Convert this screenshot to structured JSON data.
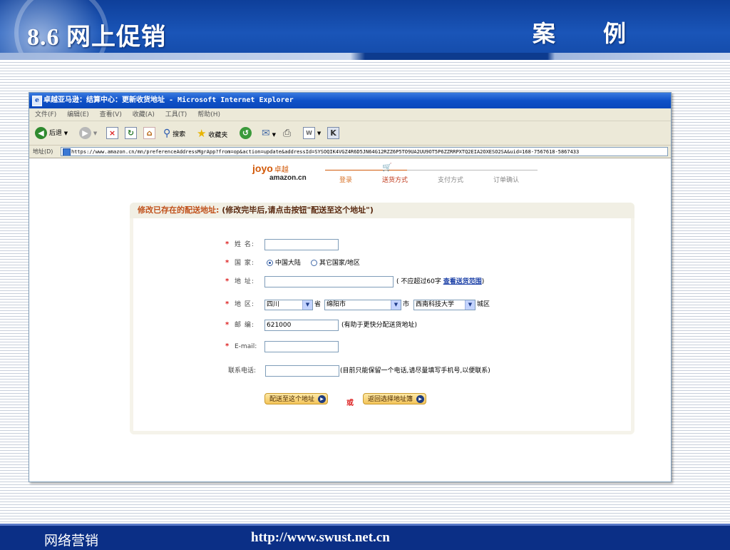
{
  "slide": {
    "title": "8.6 网上促销",
    "subtitle": "案 例",
    "footer_left": "网络营销",
    "footer_right": "http://www.swust.net.cn"
  },
  "ie": {
    "window_title": "卓越亚马逊：结算中心：更新收货地址 - Microsoft Internet Explorer",
    "menu": [
      "文件(F)",
      "编辑(E)",
      "查看(V)",
      "收藏(A)",
      "工具(T)",
      "帮助(H)"
    ],
    "toolbar": {
      "back_label": "后退",
      "search_label": "搜索",
      "favorites_label": "收藏夹"
    },
    "address_label": "地址(D)",
    "url": "https://www.amazon.cn/mn/preferenceAddressMgrApp?from=op&action=update&addressId=SYSOQIK4VGZ4R6D5JN64G12RZZ6P5TO9UA2UU9OT5P6ZZRRPXTQ2EIA2OXESO2SA&uid=168-7567618-5867433"
  },
  "logo": {
    "joyo": "joyo",
    "joyo_cn": "卓越",
    "amazon": "amazon.cn"
  },
  "steps": [
    "登录",
    "送货方式",
    "支付方式",
    "订单确认"
  ],
  "form": {
    "heading_orange": "修改已存在的配送地址:",
    "heading_dark": "(修改完毕后,请点击按钮\"配送至这个地址\")",
    "name_label": "姓  名:",
    "name_value": "",
    "country_label": "国  家:",
    "country_option_1": "中国大陆",
    "country_option_2": "其它国家/地区",
    "address_label": "地  址:",
    "address_value": "",
    "address_hint_prefix": "( 不应超过60字",
    "address_hint_link": "查看送货范围",
    "address_hint_suffix": ")",
    "region_label": "地  区:",
    "province_value": "四川",
    "province_suffix": "省",
    "city_value": "绵阳市",
    "city_suffix": "市",
    "district_value": "西南科技大学",
    "district_suffix": "城区",
    "zip_label": "邮  编:",
    "zip_value": "621000",
    "zip_hint": "(有助于更快分配送货地址)",
    "email_label": "E-mail:",
    "email_value": "",
    "phone_label": "联系电话:",
    "phone_value": "",
    "phone_hint": "(目前只能保留一个电话,请尽量填写手机号,以便联系)",
    "submit_label": "配送至这个地址",
    "or_label": "或",
    "back_label": "返回选择地址簿"
  },
  "colors": {
    "slide_blue": "#1a55b8",
    "footer_blue": "#0b2f86",
    "brand_orange": "#d25a0a",
    "required_red": "#dd2222"
  }
}
